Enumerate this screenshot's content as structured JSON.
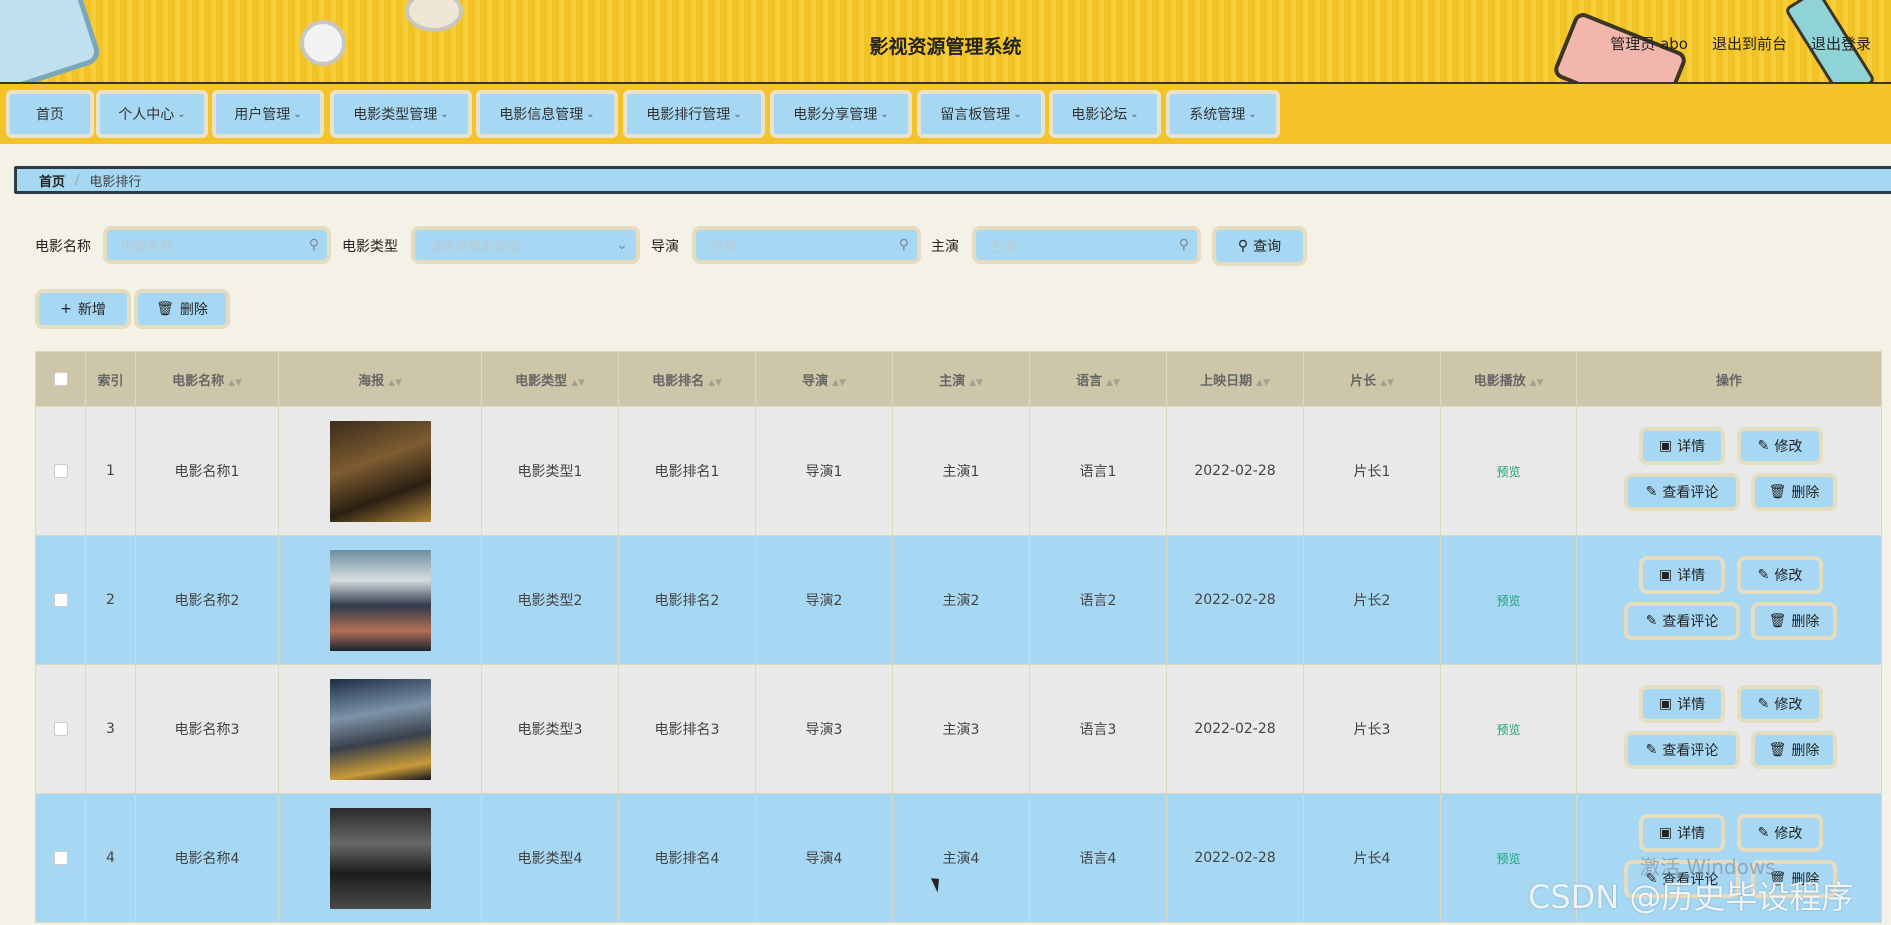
{
  "header": {
    "title": "影视资源管理系统",
    "admin": "管理员 abo",
    "exit_front": "退出到前台",
    "logout": "退出登录"
  },
  "nav": [
    {
      "label": "首页",
      "dropdown": false
    },
    {
      "label": "个人中心",
      "dropdown": true
    },
    {
      "label": "用户管理",
      "dropdown": true
    },
    {
      "label": "电影类型管理",
      "dropdown": true
    },
    {
      "label": "电影信息管理",
      "dropdown": true
    },
    {
      "label": "电影排行管理",
      "dropdown": true
    },
    {
      "label": "电影分享管理",
      "dropdown": true
    },
    {
      "label": "留言板管理",
      "dropdown": true
    },
    {
      "label": "电影论坛",
      "dropdown": true
    },
    {
      "label": "系统管理",
      "dropdown": true
    }
  ],
  "breadcrumb": {
    "home": "首页",
    "separator": "/",
    "current": "电影排行"
  },
  "search": {
    "name_label": "电影名称",
    "name_placeholder": "电影名称",
    "type_label": "电影类型",
    "type_placeholder": "请选择电影类型",
    "director_label": "导演",
    "director_placeholder": "导演",
    "actor_label": "主演",
    "actor_placeholder": "主演",
    "query_label": "查询"
  },
  "actions": {
    "add_label": "新增",
    "delete_label": "删除"
  },
  "table": {
    "headers": {
      "index": "索引",
      "name": "电影名称",
      "poster": "海报",
      "type": "电影类型",
      "rank": "电影排名",
      "director": "导演",
      "actor": "主演",
      "language": "语言",
      "release": "上映日期",
      "length": "片长",
      "play": "电影播放",
      "ops": "操作"
    },
    "rows": [
      {
        "index": "1",
        "name": "电影名称1",
        "type": "电影类型1",
        "rank": "电影排名1",
        "director": "导演1",
        "actor": "主演1",
        "language": "语言1",
        "release": "2022-02-28",
        "length": "片长1",
        "play": "预览"
      },
      {
        "index": "2",
        "name": "电影名称2",
        "type": "电影类型2",
        "rank": "电影排名2",
        "director": "导演2",
        "actor": "主演2",
        "language": "语言2",
        "release": "2022-02-28",
        "length": "片长2",
        "play": "预览"
      },
      {
        "index": "3",
        "name": "电影名称3",
        "type": "电影类型3",
        "rank": "电影排名3",
        "director": "导演3",
        "actor": "主演3",
        "language": "语言3",
        "release": "2022-02-28",
        "length": "片长3",
        "play": "预览"
      },
      {
        "index": "4",
        "name": "电影名称4",
        "type": "电影类型4",
        "rank": "电影排名4",
        "director": "导演4",
        "actor": "主演4",
        "language": "语言4",
        "release": "2022-02-28",
        "length": "片长4",
        "play": "预览"
      }
    ],
    "op_labels": {
      "detail": "详情",
      "edit": "修改",
      "comments": "查看评论",
      "delete": "删除"
    }
  },
  "watermarks": {
    "windows": "激活 Windows",
    "csdn": "CSDN @历史毕设程序"
  },
  "colors": {
    "header_yellow": "#f2c325",
    "button_blue": "#a7d8f3",
    "table_header": "#cdc6a9",
    "preview_green": "#1aa27a"
  }
}
